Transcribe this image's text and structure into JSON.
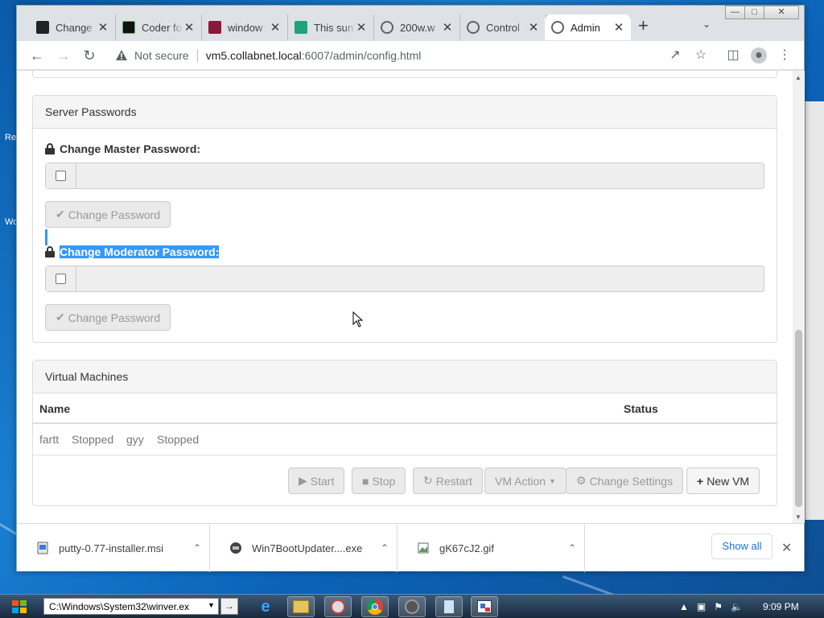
{
  "tabs": [
    {
      "title": "Change",
      "fav_color": "#222222"
    },
    {
      "title": "Coder fo",
      "fav_color": "#111111"
    },
    {
      "title": "window",
      "fav_color": "#8b1a3a"
    },
    {
      "title": "This sun",
      "fav_color": "#1fa37a"
    },
    {
      "title": "200w.w",
      "fav_color": "#5f6368"
    },
    {
      "title": "Control",
      "fav_color": "#5f6368"
    },
    {
      "title": "Admin",
      "fav_color": "#5f6368"
    }
  ],
  "toolbar": {
    "not_secure": "Not secure",
    "url_host": "vm5.collabnet.local",
    "url_path": ":6007/admin/config.html"
  },
  "server_passwords": {
    "heading": "Server Passwords",
    "master_label": "Change Master Password:",
    "moderator_label": "Change Moderator Password:",
    "change_button": "Change Password"
  },
  "virtual_machines": {
    "heading": "Virtual Machines",
    "columns": [
      "Name",
      "Status"
    ],
    "row_cells": [
      "fartt",
      "Stopped",
      "gyy",
      "Stopped"
    ],
    "buttons": {
      "start": "Start",
      "stop": "Stop",
      "restart": "Restart",
      "vm_action": "VM Action",
      "change_settings": "Change Settings",
      "new_vm": "New VM"
    }
  },
  "downloads": {
    "items": [
      "putty-0.77-installer.msi",
      "Win7BootUpdater....exe",
      "gK67cJ2.gif"
    ],
    "show_all": "Show all"
  },
  "taskbar": {
    "run_text": "C:\\Windows\\System32\\winver.ex",
    "clock": "9:09 PM"
  },
  "desktop_labels": [
    "Re",
    "Wo"
  ]
}
